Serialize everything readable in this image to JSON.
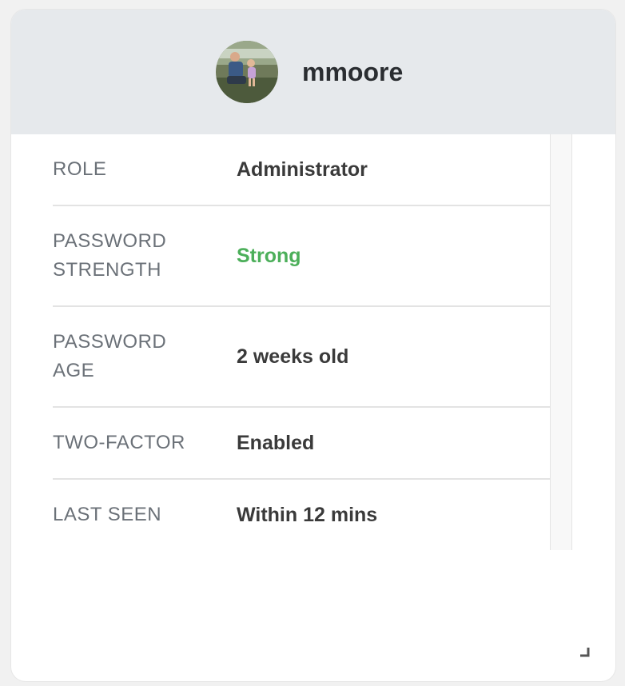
{
  "user": {
    "username": "mmoore",
    "avatar_icon": "user-avatar-photo"
  },
  "details": [
    {
      "label": "ROLE",
      "value": "Administrator",
      "status": "normal"
    },
    {
      "label": "PASSWORD STRENGTH",
      "value": "Strong",
      "status": "good"
    },
    {
      "label": "PASSWORD AGE",
      "value": "2 weeks old",
      "status": "normal"
    },
    {
      "label": "TWO-FACTOR",
      "value": "Enabled",
      "status": "normal"
    },
    {
      "label": "LAST SEEN",
      "value": "Within 12 mins",
      "status": "normal"
    }
  ],
  "colors": {
    "header_bg": "#e6e9ec",
    "good": "#4caf5a",
    "label": "#6b7178",
    "value": "#3a3a3a"
  }
}
